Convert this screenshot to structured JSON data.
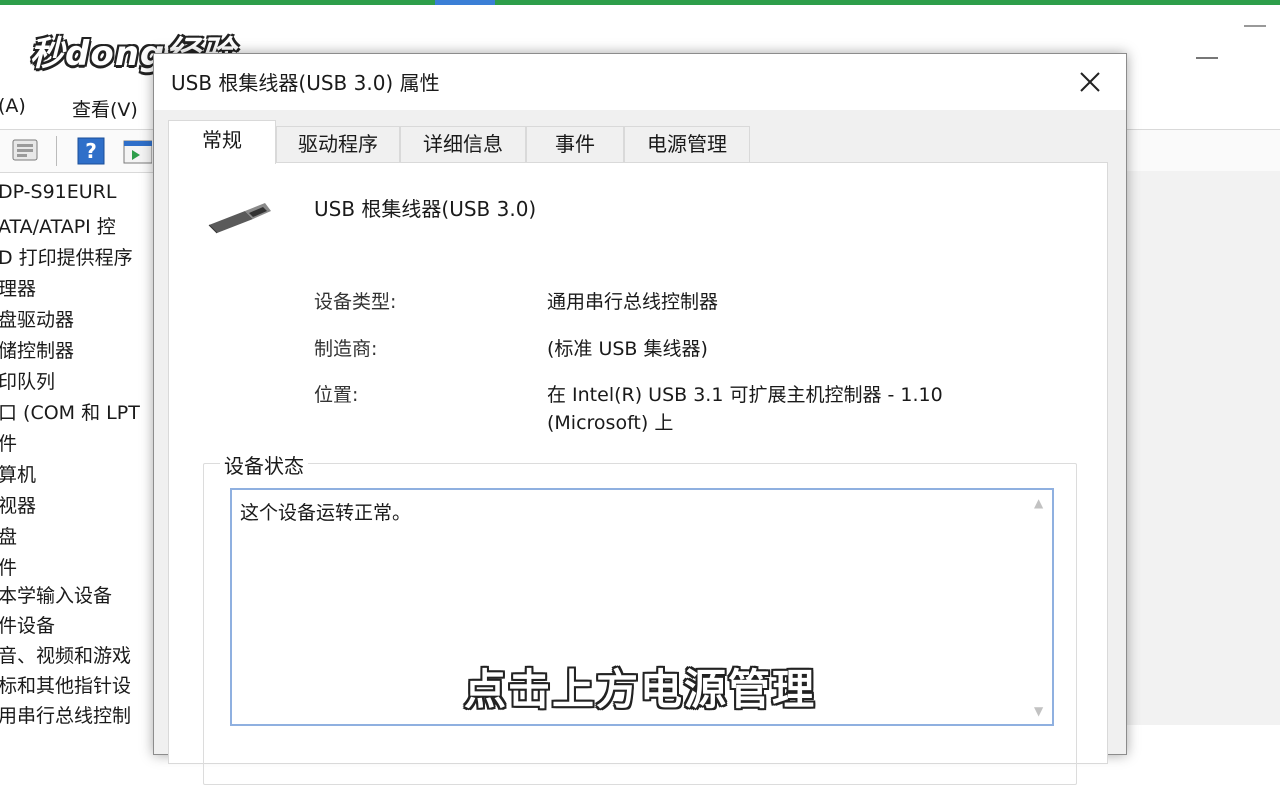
{
  "logo": {
    "text": "秒dong经验"
  },
  "background": {
    "menu": [
      "(A)",
      "查看(V)"
    ],
    "tree": [
      "DP-S91EURL",
      "ATA/ATAPI 控",
      "D 打印提供程序",
      "理器",
      "盘驱动器",
      "储控制器",
      "印队列",
      "口 (COM 和 LPT",
      "件",
      "算机",
      "视器",
      "盘",
      "件",
      "本学输入设备",
      "件设备",
      "音、视频和游戏",
      "标和其他指针设",
      "用串行总线控制"
    ]
  },
  "dialog": {
    "title": "USB 根集线器(USB 3.0) 属性",
    "tabs": [
      "常规",
      "驱动程序",
      "详细信息",
      "事件",
      "电源管理"
    ],
    "device_name": "USB 根集线器(USB 3.0)",
    "properties": [
      {
        "label": "设备类型:",
        "value": "通用串行总线控制器"
      },
      {
        "label": "制造商:",
        "value": "(标准 USB 集线器)"
      },
      {
        "label": "位置:",
        "value": "在 Intel(R) USB 3.1 可扩展主机控制器 - 1.10",
        "value2": "(Microsoft) 上"
      }
    ],
    "status_group_label": "设备状态",
    "status_text": "这个设备运转正常。"
  },
  "caption": "点击上方电源管理"
}
